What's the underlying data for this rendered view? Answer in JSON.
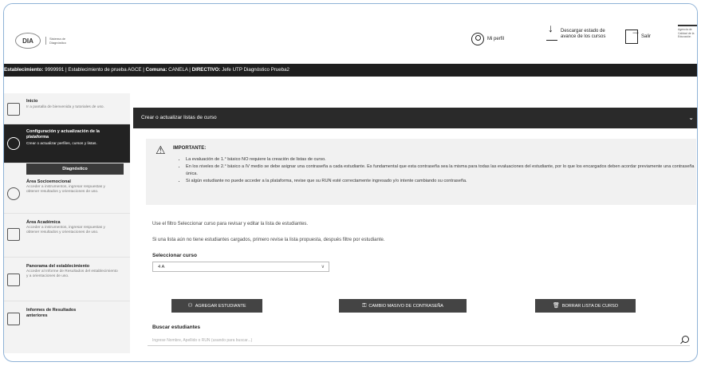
{
  "header": {
    "logo_mark": "DIA",
    "logo_text": "Sistema de Diagnóstico",
    "profile_label": "Mi perfil",
    "download_label": "Descargar estado de avance de los cursos",
    "logout_label": "Salir",
    "agency_text": "Agencia de Calidad de la Educación"
  },
  "infobar": {
    "estab_label": "Establecimiento:",
    "estab_value": "9999991 | Establecimiento de prueba AGCE |",
    "comuna_label": "Comuna:",
    "comuna_value": "CANELA |",
    "directivo_label": "DIRECTIVO:",
    "directivo_value": "Jefe UTP Diagnóstico Prueba2"
  },
  "sidebar": {
    "items": [
      {
        "title": "Inicio",
        "desc": "Ir a pantalla de bienvenida y tutoriales de uso."
      },
      {
        "title": "Configuración y actualización de la plataforma",
        "desc": "Crear o actualizar perfiles, cursos y listas."
      },
      {
        "title": "Área Socioemocional",
        "desc": "Acceder a instrumentos, ingresar respuestas y obtener resultados y orientaciones de uso."
      },
      {
        "title": "Área Académica",
        "desc": "Acceder a instrumentos, ingresar respuestas y obtener resultados y orientaciones de uso."
      },
      {
        "title": "Panorama del establecimiento",
        "desc": "Acceder al Informe de Resultados del establecimiento y a orientaciones de uso."
      },
      {
        "title": "Informes de Resultados anteriores",
        "desc": ""
      }
    ],
    "section_label": "Diagnóstico"
  },
  "main": {
    "panel_title": "Crear o actualizar listas de curso",
    "warning": {
      "title": "IMPORTANTE:",
      "bullets": [
        "La evaluación de 1.° básico NO requiere la creación de listas de curso.",
        "En los niveles de 2.° básico a IV medio se debe asignar una contraseña a cada estudiante. Es fundamental que esta contraseña sea la misma para todas las evaluaciones del estudiante, por lo que los encargados deben acordar previamente una contraseña única.",
        "Si algún estudiante no puede acceder a la plataforma, revise que su RUN esté correctamente ingresado y/o intente cambiando su contraseña."
      ]
    },
    "hint1": "Use el filtro Seleccionar curso para revisar y editar la lista de estudiantes.",
    "hint2": "Si una lista aún no tiene estudiantes cargados, primero revise la lista propuesta, después filtre por estudiante.",
    "select_label": "Seleccionar curso",
    "select_value": "4 A",
    "buttons": {
      "add": "AGREGAR ESTUDIANTE",
      "password": "CAMBIO MASIVO DE CONTRASEÑA",
      "delete": "BORRAR LISTA DE CURSO"
    },
    "search_label": "Buscar estudiantes",
    "search_placeholder": "Ingrese Nombre, Apellido o RUN (usando para buscar...)"
  }
}
